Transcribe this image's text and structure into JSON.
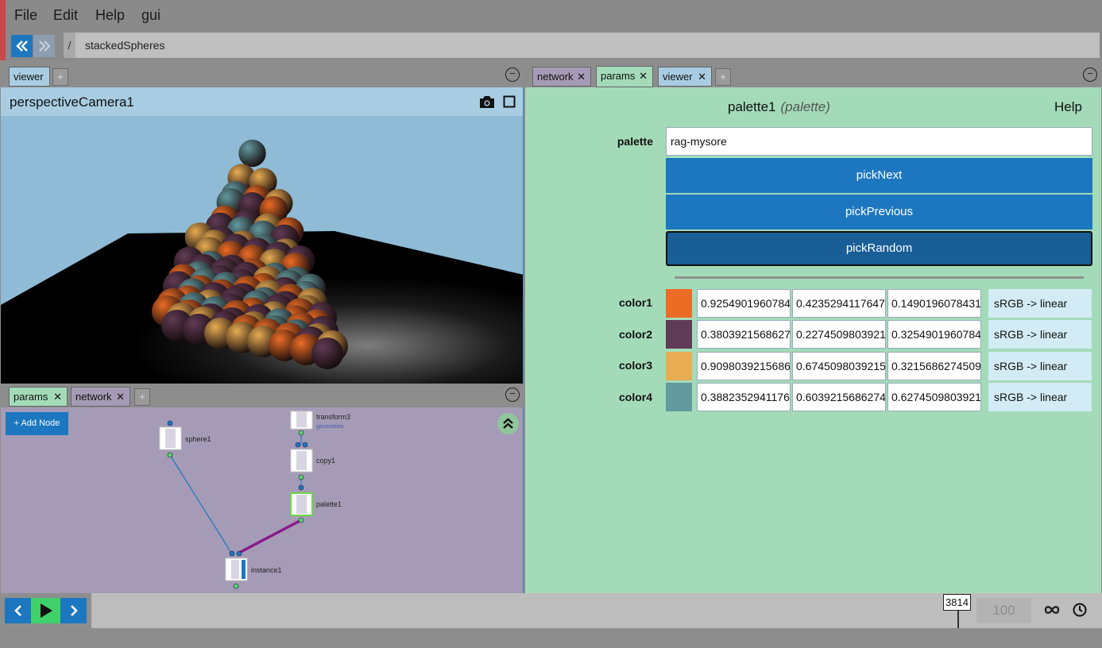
{
  "menu": [
    "File",
    "Edit",
    "Help",
    "gui"
  ],
  "breadcrumb": {
    "separator": "/",
    "path": "stackedSpheres"
  },
  "left_top_tabs": {
    "tabs": [
      {
        "label": "viewer"
      }
    ],
    "add": "+",
    "minimize": "−"
  },
  "viewer": {
    "camera": "perspectiveCamera1",
    "icons": [
      "camera-icon",
      "frame-icon"
    ]
  },
  "left_bottom_tabs": {
    "tabs": [
      {
        "label": "params",
        "close": "✕"
      },
      {
        "label": "network",
        "close": "✕"
      }
    ],
    "add": "+",
    "minimize": "−"
  },
  "network": {
    "add_node": "+ Add Node",
    "nodes": [
      {
        "label": "sphere1"
      },
      {
        "label": "transform3",
        "sub": "geometries"
      },
      {
        "label": "copy1"
      },
      {
        "label": "palette1"
      },
      {
        "label": "instance1"
      }
    ]
  },
  "right_tabs": {
    "tabs": [
      {
        "label": "network",
        "close": "✕"
      },
      {
        "label": "params",
        "close": "✕"
      },
      {
        "label": "viewer",
        "close": "✕"
      }
    ],
    "add": "+",
    "minimize": "−"
  },
  "params": {
    "node_name": "palette1",
    "node_type": "(palette)",
    "help": "Help",
    "palette_label": "palette",
    "palette_value": "rag-mysore",
    "buttons": [
      "pickNext",
      "pickPrevious",
      "pickRandom"
    ],
    "colors": [
      {
        "label": "color1",
        "swatch": "#ec6c26",
        "r": "0.9254901960784",
        "g": "0.4235294117647",
        "b": "0.1490196078431",
        "mode": "sRGB -> linear"
      },
      {
        "label": "color2",
        "swatch": "#603b55",
        "r": "0.3803921568627",
        "g": "0.2274509803921",
        "b": "0.3254901960784",
        "mode": "sRGB -> linear"
      },
      {
        "label": "color3",
        "swatch": "#e8ac52",
        "r": "0.9098039215686",
        "g": "0.6745098039215",
        "b": "0.3215686274509",
        "mode": "sRGB -> linear"
      },
      {
        "label": "color4",
        "swatch": "#639aa0",
        "r": "0.3882352941176",
        "g": "0.6039215686274",
        "b": "0.6274509803921",
        "mode": "sRGB -> linear"
      }
    ]
  },
  "timeline": {
    "current_frame": "3814",
    "end_frame": "100",
    "icons": [
      "prev-icon",
      "play-icon",
      "next-icon",
      "loop-icon",
      "clock-icon"
    ]
  },
  "colors": {
    "accent_blue": "#1c77c0",
    "params_bg": "#a3dbb9",
    "network_bg": "#a59bb6",
    "viewer_header": "#a8cde2",
    "play_green": "#3fd16a"
  }
}
